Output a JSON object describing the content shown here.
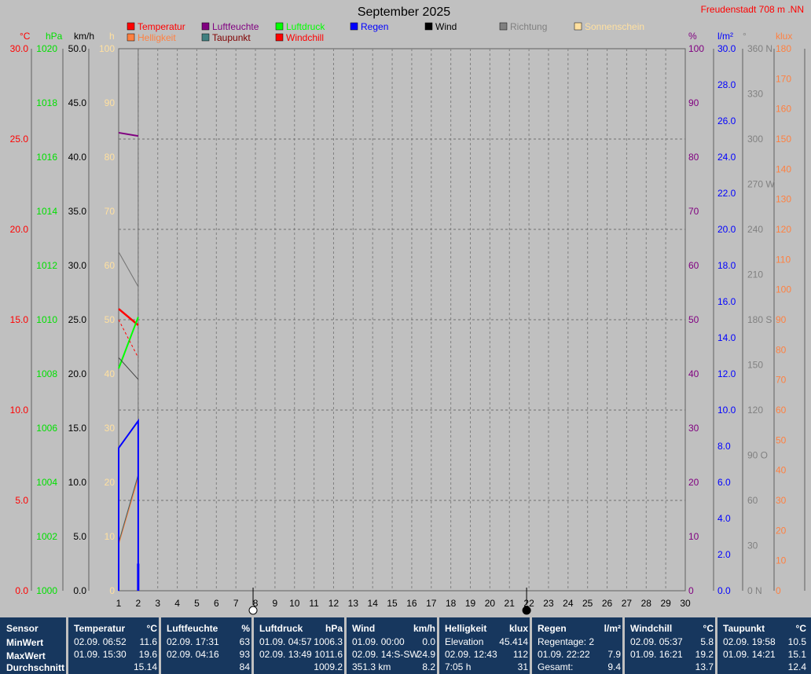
{
  "chart_data": {
    "type": "line",
    "title": "September 2025",
    "station": "Freudenstadt 708 m .NN",
    "x": [
      1,
      2,
      3,
      4,
      5,
      6,
      7,
      8,
      9,
      10,
      11,
      12,
      13,
      14,
      15,
      16,
      17,
      18,
      19,
      20,
      21,
      22,
      23,
      24,
      25,
      26,
      27,
      28,
      29,
      30
    ],
    "moon_phases": [
      {
        "day": 8,
        "phase": "full-moon"
      },
      {
        "day": 22,
        "phase": "new-moon"
      }
    ],
    "axes": [
      {
        "id": "temp",
        "unit": "°C",
        "color": "#ff0000",
        "min": 0,
        "max": 30,
        "ticks": [
          "0.0",
          "5.0",
          "10.0",
          "15.0",
          "20.0",
          "25.0",
          "30.0"
        ]
      },
      {
        "id": "press",
        "unit": "hPa",
        "color": "#00e000",
        "min": 1000,
        "max": 1020,
        "ticks": [
          "1000",
          "1002",
          "1004",
          "1006",
          "1008",
          "1010",
          "1012",
          "1014",
          "1016",
          "1018",
          "1020"
        ]
      },
      {
        "id": "wind",
        "unit": "km/h",
        "color": "#000000",
        "min": 0,
        "max": 50,
        "ticks": [
          "0.0",
          "5.0",
          "10.0",
          "15.0",
          "20.0",
          "25.0",
          "30.0",
          "35.0",
          "40.0",
          "45.0",
          "50.0"
        ]
      },
      {
        "id": "sun",
        "unit": "h",
        "color": "#ffe0a0",
        "min": 0,
        "max": 100,
        "ticks": [
          "0",
          "10",
          "20",
          "30",
          "40",
          "50",
          "60",
          "70",
          "80",
          "90",
          "100"
        ]
      },
      {
        "id": "hum",
        "unit": "%",
        "color": "#800080",
        "min": 0,
        "max": 100,
        "ticks": [
          "0",
          "10",
          "20",
          "30",
          "40",
          "50",
          "60",
          "70",
          "80",
          "90",
          "100"
        ]
      },
      {
        "id": "rain",
        "unit": "l/m²",
        "color": "#0000ff",
        "min": 0,
        "max": 30,
        "ticks": [
          "0.0",
          "2.0",
          "4.0",
          "6.0",
          "8.0",
          "10.0",
          "12.0",
          "14.0",
          "16.0",
          "18.0",
          "20.0",
          "22.0",
          "24.0",
          "26.0",
          "28.0",
          "30.0"
        ]
      },
      {
        "id": "dir",
        "unit": "°",
        "color": "#808080",
        "min": 0,
        "max": 360,
        "ticks": [
          "0",
          "30",
          "60",
          "90",
          "120",
          "150",
          "180",
          "210",
          "240",
          "270",
          "300",
          "330",
          "360"
        ],
        "tick_suffix": [
          "N",
          "",
          "",
          "O",
          "",
          "",
          "S",
          "",
          "",
          "W",
          "",
          "",
          "N"
        ]
      },
      {
        "id": "lux",
        "unit": "klux",
        "color": "#ff8040",
        "min": 0,
        "max": 180,
        "ticks": [
          "0",
          "10",
          "20",
          "30",
          "40",
          "50",
          "60",
          "70",
          "80",
          "90",
          "100",
          "110",
          "120",
          "130",
          "140",
          "150",
          "160",
          "170",
          "180"
        ]
      }
    ],
    "legend": [
      {
        "name": "Temperatur",
        "color": "#ff0000",
        "text_color": "#ff0000"
      },
      {
        "name": "Luftfeuchte",
        "color": "#800080",
        "text_color": "#800080"
      },
      {
        "name": "Luftdruck",
        "color": "#00ff00",
        "text_color": "#00ff00"
      },
      {
        "name": "Regen",
        "color": "#0000ff",
        "text_color": "#0000ff"
      },
      {
        "name": "Wind",
        "color": "#000000",
        "text_color": "#000000"
      },
      {
        "name": "Richtung",
        "color": "#808080",
        "text_color": "#808080"
      },
      {
        "name": "Sonnenschein",
        "color": "#ffe0a0",
        "text_color": "#ffe0a0"
      },
      {
        "name": "Helligkeit",
        "color": "#ff8040",
        "text_color": "#ff8040"
      },
      {
        "name": "Taupunkt",
        "color": "#408080",
        "text_color": "#800000"
      },
      {
        "name": "Windchill",
        "color": "#ff0000",
        "text_color": "#ff0000"
      }
    ],
    "series": [
      {
        "name": "Temperatur",
        "axis": "temp",
        "color": "#ff0000",
        "width": 2.5,
        "x": [
          1,
          2
        ],
        "y": [
          15.6,
          14.7
        ]
      },
      {
        "name": "Luftfeuchte",
        "axis": "hum",
        "color": "#800080",
        "width": 2,
        "x": [
          1,
          2
        ],
        "y": [
          84.5,
          83.9
        ]
      },
      {
        "name": "Luftdruck",
        "axis": "press",
        "color": "#00ff00",
        "width": 2,
        "x": [
          1,
          2
        ],
        "y": [
          1008.2,
          1010.1
        ]
      },
      {
        "name": "Wind",
        "axis": "wind",
        "color": "#404040",
        "width": 1,
        "x": [
          1,
          2
        ],
        "y": [
          21.5,
          19.5
        ]
      },
      {
        "name": "Richtung",
        "axis": "dir",
        "color": "#707070",
        "width": 1,
        "x": [
          1,
          2
        ],
        "y": [
          225,
          202
        ]
      },
      {
        "name": "Windchill",
        "axis": "temp",
        "color": "#ff0000",
        "width": 1,
        "dash": "3,3",
        "x": [
          1,
          2
        ],
        "y": [
          15.0,
          12.9
        ]
      },
      {
        "name": "Helligkeit",
        "axis": "lux",
        "color": "#ff8040",
        "width": 1.5,
        "x": [
          1,
          2
        ],
        "y": [
          15.6,
          37.7
        ]
      },
      {
        "name": "Taupunkt",
        "axis": "lux",
        "color": "#406060",
        "width": 1,
        "x": [
          1,
          2
        ],
        "y": [
          16.0,
          38.5
        ]
      },
      {
        "name": "Regen",
        "axis": "rain",
        "color": "#0000ff",
        "width": 2,
        "x": [
          1,
          1,
          2,
          2
        ],
        "y": [
          0,
          7.9,
          9.4,
          0
        ]
      }
    ],
    "bars": [
      {
        "name": "Sonnenschein",
        "axis": "sun",
        "color": "#ffe0a0",
        "x": 2,
        "y": 4.5
      },
      {
        "name": "Regen",
        "axis": "rain",
        "color": "#0000ff",
        "x": 2,
        "y": 1.5
      }
    ],
    "grid": true
  },
  "stats": {
    "row_labels": [
      "Sensor",
      "MinWert",
      "MaxWert",
      "Durchschnitt"
    ],
    "columns": [
      {
        "name": "Temperatur",
        "unit": "°C",
        "min": [
          "02.09.  06:52",
          "11.6"
        ],
        "max": [
          "01.09.  15:30",
          "19.6"
        ],
        "avg": [
          "",
          "15.14"
        ]
      },
      {
        "name": "Luftfeuchte",
        "unit": "%",
        "min": [
          "02.09.  17:31",
          "63"
        ],
        "max": [
          "02.09.  04:16",
          "93"
        ],
        "avg": [
          "",
          "84"
        ]
      },
      {
        "name": "Luftdruck",
        "unit": "hPa",
        "min": [
          "01.09.  04:57",
          "1006.3"
        ],
        "max": [
          "02.09.  13:49",
          "1011.6"
        ],
        "avg": [
          "",
          "1009.2"
        ]
      },
      {
        "name": "Wind",
        "unit": "km/h",
        "min": [
          "01.09.  00:00",
          "0.0"
        ],
        "max": [
          "02.09.  14:S-SW",
          "24.9"
        ],
        "avg": [
          "351.3 km",
          "8.2"
        ]
      },
      {
        "name": "Helligkeit",
        "unit": "klux",
        "min": [
          "Elevation",
          "45.414"
        ],
        "max": [
          "02.09.  12:43",
          "112"
        ],
        "avg": [
          "7:05 h",
          "31"
        ]
      },
      {
        "name": "Regen",
        "unit": "l/m²",
        "min": [
          "Regentage: 2",
          ""
        ],
        "max": [
          "01.09.  22:22",
          "7.9"
        ],
        "avg": [
          "Gesamt:",
          "9.4"
        ]
      },
      {
        "name": "Windchill",
        "unit": "°C",
        "min": [
          "02.09.  05:37",
          "5.8"
        ],
        "max": [
          "01.09.  16:21",
          "19.2"
        ],
        "avg": [
          "",
          "13.7"
        ]
      },
      {
        "name": "Taupunkt",
        "unit": "°C",
        "min": [
          "02.09.  19:58",
          "10.5"
        ],
        "max": [
          "01.09.  14:21",
          "15.1"
        ],
        "avg": [
          "",
          "12.4"
        ]
      }
    ]
  }
}
